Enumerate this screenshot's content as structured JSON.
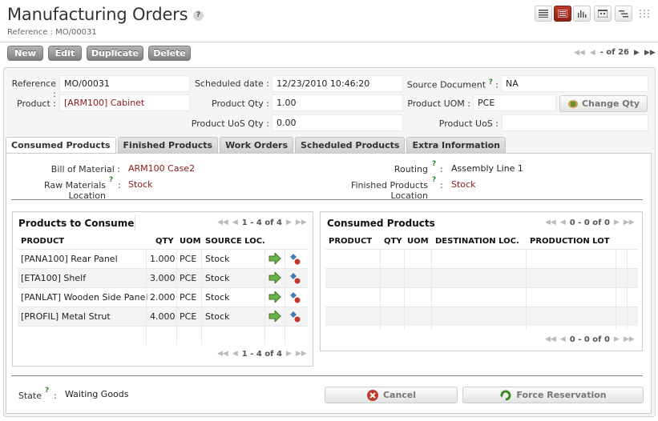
{
  "header": {
    "title": "Manufacturing Orders",
    "help": "?",
    "subtitle": "Reference : MO/00031"
  },
  "toolbar": {
    "new_label": "New",
    "edit_label": "Edit",
    "duplicate_label": "Duplicate",
    "delete_label": "Delete",
    "pager_text": "- of 26"
  },
  "form": {
    "reference_label": "Reference :",
    "reference_value": "MO/00031",
    "scheduled_label": "Scheduled date :",
    "scheduled_value": "12/23/2010 10:46:20",
    "source_label": "Source Document",
    "source_value": "NA",
    "product_label": "Product :",
    "product_value": "[ARM100] Cabinet",
    "qty_label": "Product Qty :",
    "qty_value": "1.00",
    "uom_label": "Product UOM :",
    "uom_value": "PCE",
    "change_qty_label": "Change Qty",
    "uos_qty_label": "Product UoS Qty :",
    "uos_qty_value": "0.00",
    "uos_label": "Product UoS :",
    "uos_value": "",
    "help": "?"
  },
  "tabs": [
    "Consumed Products",
    "Finished Products",
    "Work Orders",
    "Scheduled Products",
    "Extra Information"
  ],
  "consumed_tab": {
    "bom_label": "Bill of Material :",
    "bom_value": "ARM100 Case2",
    "routing_label": "Routing",
    "routing_value": "Assembly Line 1",
    "raw_loc_label": "Raw Materials Location",
    "raw_loc_value": "Stock",
    "fin_loc_label": "Finished Products Location",
    "fin_loc_value": "Stock"
  },
  "to_consume": {
    "title": "Products to Consume",
    "pager": "1 - 4 of 4",
    "headers": [
      "PRODUCT",
      "QTY",
      "UOM",
      "SOURCE LOC."
    ],
    "rows": [
      {
        "product": "[PANA100] Rear Panel",
        "qty": "1.000",
        "uom": "PCE",
        "loc": "Stock"
      },
      {
        "product": "[ETA100] Shelf",
        "qty": "3.000",
        "uom": "PCE",
        "loc": "Stock"
      },
      {
        "product": "[PANLAT] Wooden Side Panel",
        "qty": "2.000",
        "uom": "PCE",
        "loc": "Stock"
      },
      {
        "product": "[PROFIL] Metal Strut",
        "qty": "4.000",
        "uom": "PCE",
        "loc": "Stock"
      }
    ]
  },
  "consumed": {
    "title": "Consumed Products",
    "pager": "0 - 0 of 0",
    "headers": [
      "PRODUCT",
      "QTY",
      "UOM",
      "DESTINATION LOC.",
      "PRODUCTION LOT"
    ]
  },
  "footer": {
    "state_label": "State",
    "state_value": "Waiting Goods",
    "cancel_label": "Cancel",
    "force_label": "Force Reservation"
  },
  "colors": {
    "accent": "#8b1a1a",
    "active_view": "#c0392b",
    "button": "#999999"
  }
}
